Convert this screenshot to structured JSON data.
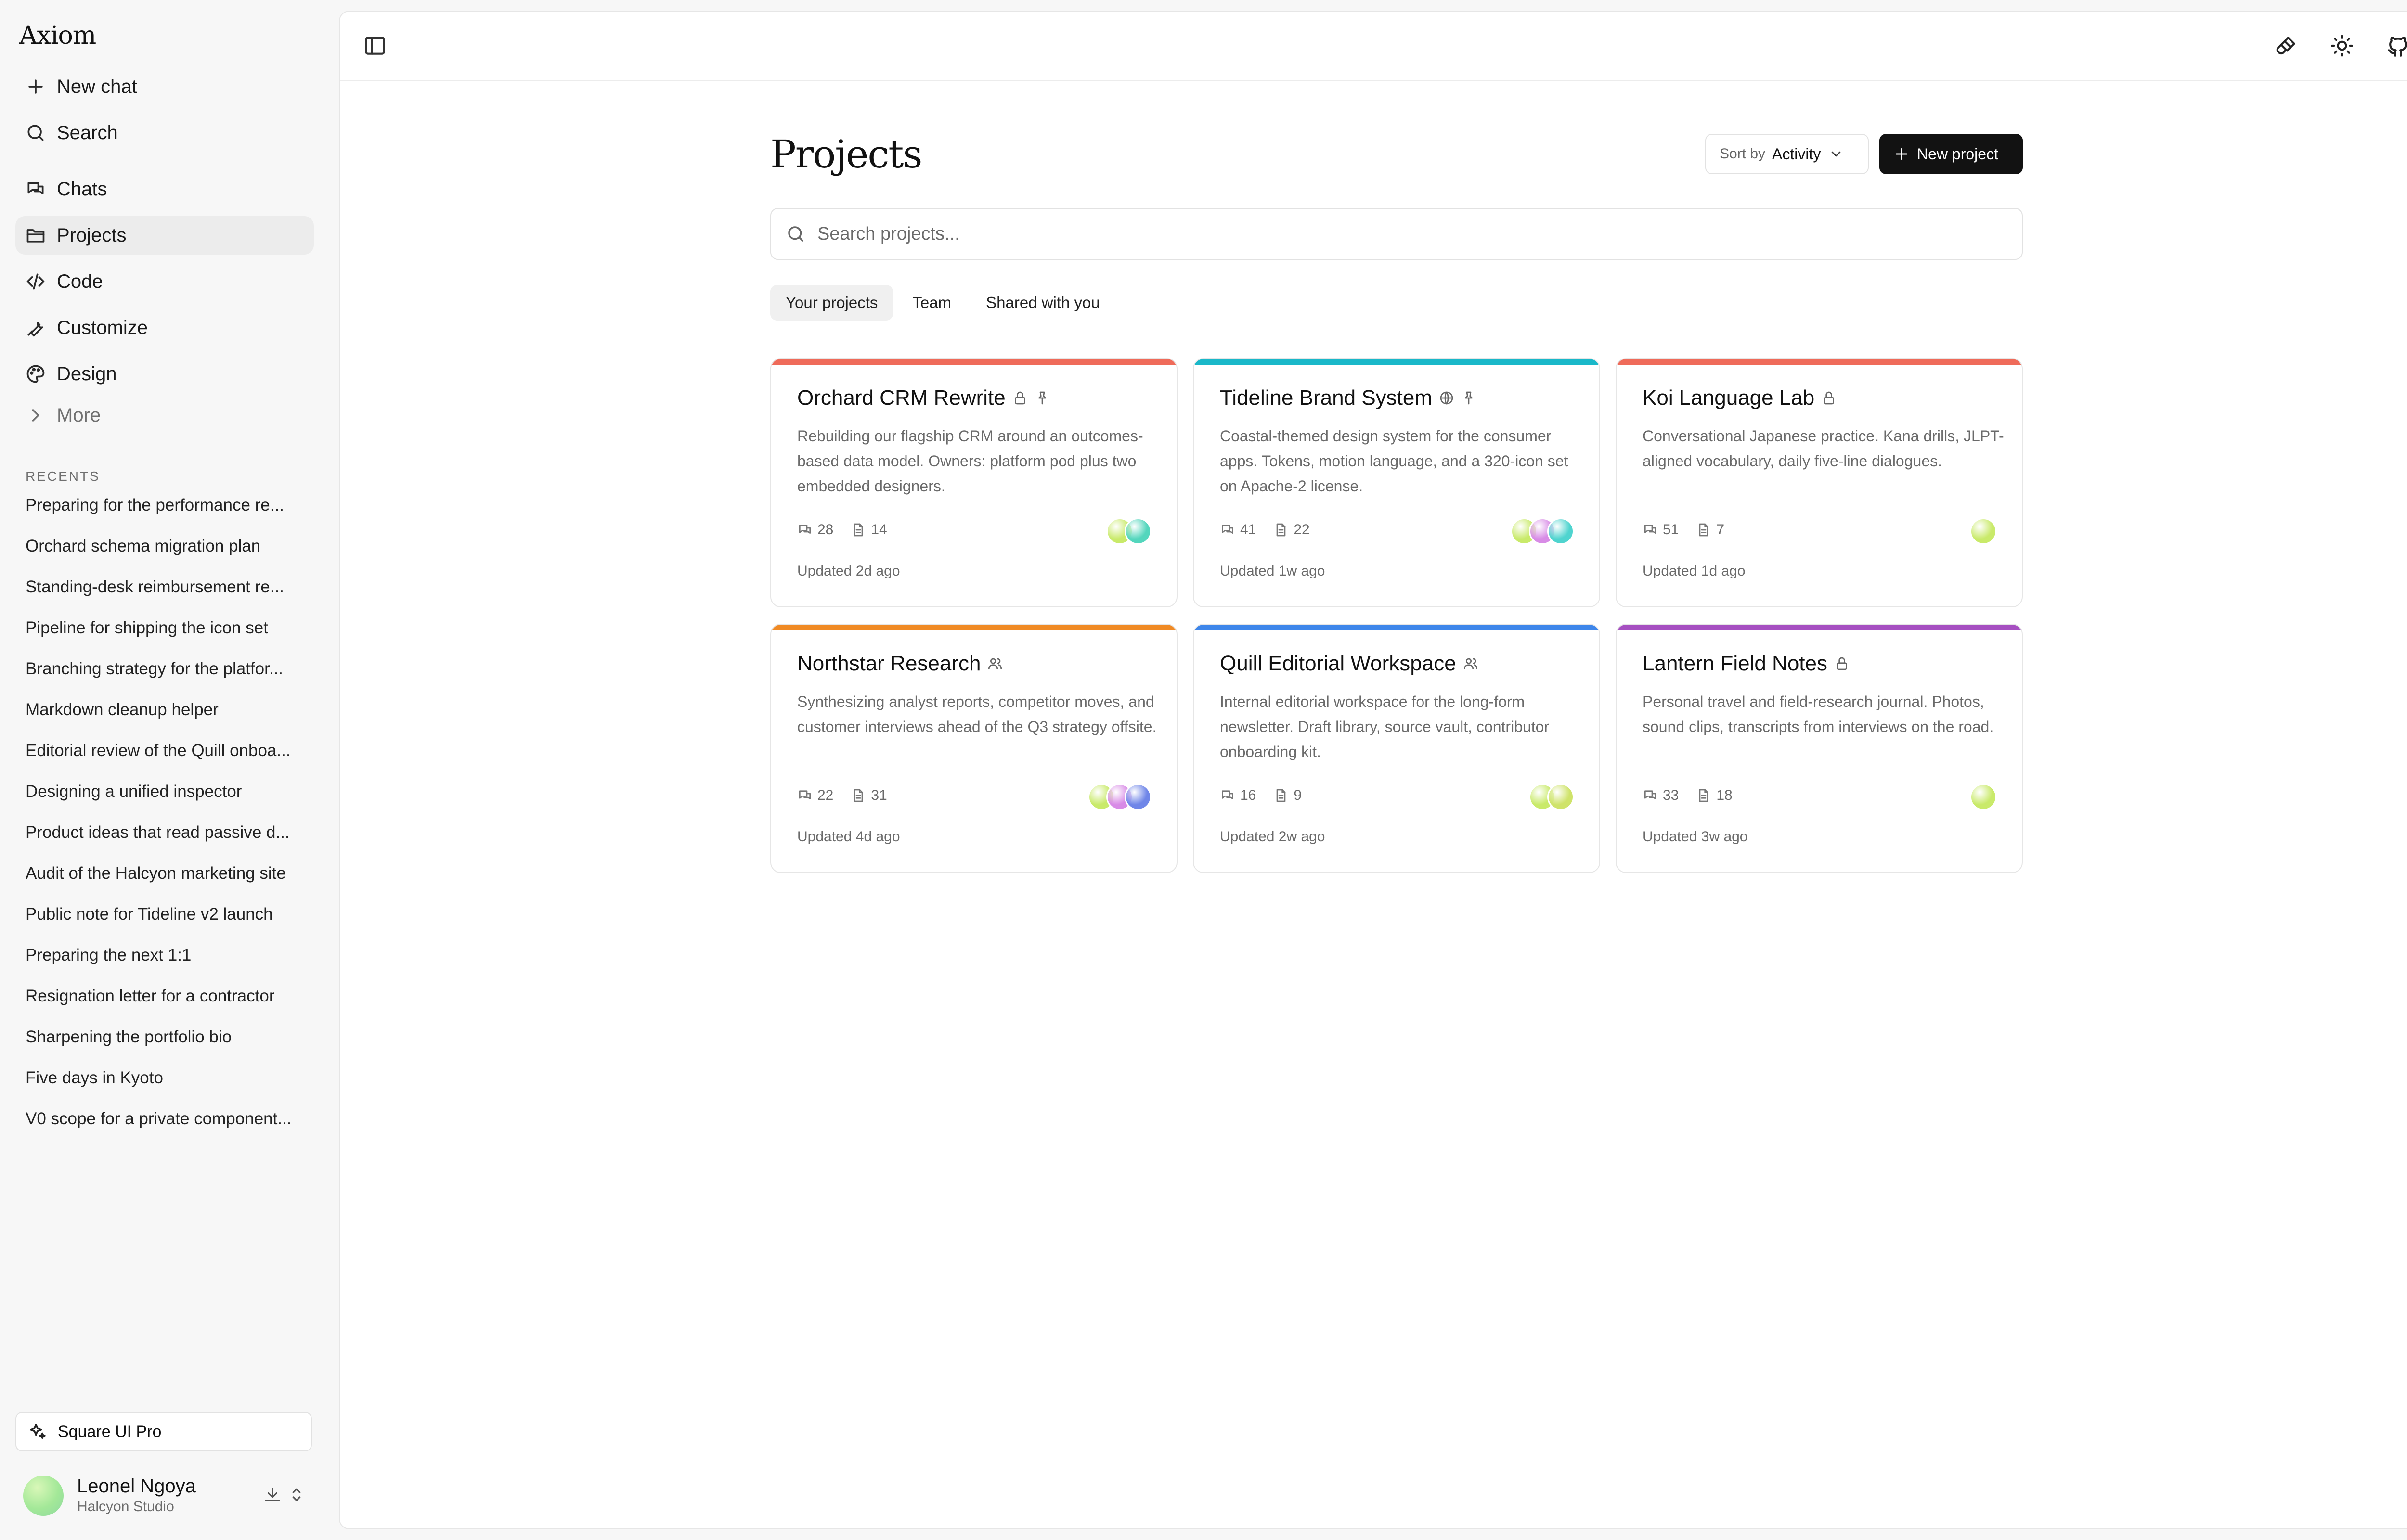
{
  "app": {
    "brand": "Axiom"
  },
  "sidebar": {
    "actions": [
      {
        "label": "New chat",
        "icon": "plus-icon"
      },
      {
        "label": "Search",
        "icon": "search-icon"
      }
    ],
    "nav": [
      {
        "label": "Chats",
        "icon": "chats-icon"
      },
      {
        "label": "Projects",
        "icon": "folder-icon",
        "active": true
      },
      {
        "label": "Code",
        "icon": "code-icon"
      },
      {
        "label": "Customize",
        "icon": "wrench-icon"
      },
      {
        "label": "Design",
        "icon": "palette-icon"
      }
    ],
    "more_label": "More",
    "recents_label": "RECENTS",
    "recents": [
      "Preparing for the performance re...",
      "Orchard schema migration plan",
      "Standing-desk reimbursement re...",
      "Pipeline for shipping the icon set",
      "Branching strategy for the platfor...",
      "Markdown cleanup helper",
      "Editorial review of the Quill onboa...",
      "Designing a unified inspector",
      "Product ideas that read passive d...",
      "Audit of the Halcyon marketing site",
      "Public note for Tideline v2 launch",
      "Preparing the next 1:1",
      "Resignation letter for a contractor",
      "Sharpening the portfolio bio",
      "Five days in Kyoto",
      "V0 scope for a private component..."
    ],
    "pro_label": "Square UI Pro",
    "user": {
      "name": "Leonel Ngoya",
      "org": "Halcyon Studio"
    }
  },
  "topbar": {
    "icons": [
      "paintbrush-icon",
      "sun-icon",
      "github-icon"
    ]
  },
  "main": {
    "title": "Projects",
    "sort": {
      "label": "Sort by",
      "value": "Activity"
    },
    "new_project_label": "New project",
    "search_placeholder": "Search projects...",
    "tabs": [
      {
        "label": "Your projects",
        "active": true
      },
      {
        "label": "Team"
      },
      {
        "label": "Shared with you"
      }
    ]
  },
  "projects": [
    {
      "title": "Orchard CRM Rewrite",
      "badges": [
        "lock-icon",
        "pin-icon"
      ],
      "color": "#ef6b5a",
      "description": "Rebuilding our flagship CRM around an outcomes-based data model. Owners: platform pod plus two embedded designers.",
      "chats": "28",
      "files": "14",
      "updated": "Updated 2d ago",
      "avatars": [
        "#c9ea6a",
        "#54d6bd"
      ]
    },
    {
      "title": "Tideline Brand System",
      "badges": [
        "globe-icon",
        "pin-icon"
      ],
      "color": "#1ab8c9",
      "description": "Coastal-themed design system for the consumer apps. Tokens, motion language, and a 320-icon set on Apache-2 license.",
      "chats": "41",
      "files": "22",
      "updated": "Updated 1w ago",
      "avatars": [
        "#c9ea6a",
        "#d88be6",
        "#4fd4cf"
      ]
    },
    {
      "title": "Koi Language Lab",
      "badges": [
        "lock-icon"
      ],
      "color": "#ef6b5a",
      "description": "Conversational Japanese practice. Kana drills, JLPT-aligned vocabulary, daily five-line dialogues.",
      "chats": "51",
      "files": "7",
      "updated": "Updated 1d ago",
      "avatars": [
        "#c9ea6a"
      ]
    },
    {
      "title": "Northstar Research",
      "badges": [
        "users-icon"
      ],
      "color": "#f08a24",
      "description": "Synthesizing analyst reports, competitor moves, and customer interviews ahead of the Q3 strategy offsite.",
      "chats": "22",
      "files": "31",
      "updated": "Updated 4d ago",
      "avatars": [
        "#c9ea6a",
        "#d88be6",
        "#6f86e8"
      ]
    },
    {
      "title": "Quill Editorial Workspace",
      "badges": [
        "users-icon"
      ],
      "color": "#3e86ea",
      "description": "Internal editorial workspace for the long-form newsletter. Draft library, source vault, contributor onboarding kit.",
      "chats": "16",
      "files": "9",
      "updated": "Updated 2w ago",
      "avatars": [
        "#c9ea6a",
        "#cfe36a"
      ]
    },
    {
      "title": "Lantern Field Notes",
      "badges": [
        "lock-icon"
      ],
      "color": "#a64fc1",
      "description": "Personal travel and field-research journal. Photos, sound clips, transcripts from interviews on the road.",
      "chats": "33",
      "files": "18",
      "updated": "Updated 3w ago",
      "avatars": [
        "#c9ea6a"
      ]
    }
  ]
}
